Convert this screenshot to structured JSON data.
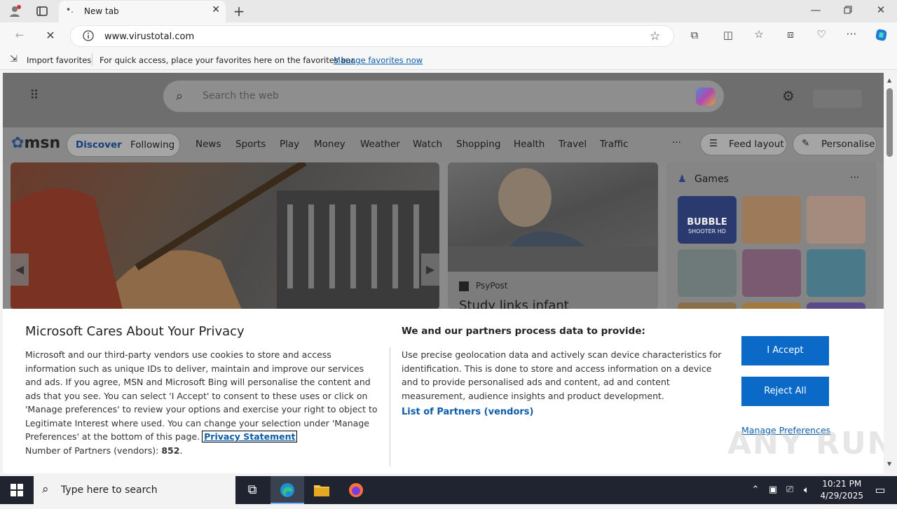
{
  "browser": {
    "tab_title": "New tab",
    "url": "www.virustotal.com",
    "favorites_bar": {
      "import_label": "Import favorites",
      "hint": "For quick access, place your favorites here on the favorites bar.",
      "manage_link": "Manage favorites now"
    }
  },
  "msn": {
    "search_placeholder": "Search the web",
    "logo": "msn",
    "tabs": [
      "Discover",
      "Following"
    ],
    "nav_items": [
      "News",
      "Sports",
      "Play",
      "Money",
      "Weather",
      "Watch",
      "Shopping",
      "Health",
      "Travel",
      "Traffic"
    ],
    "more": "···",
    "feed_layout": "Feed layout",
    "personalise": "Personalise",
    "article": {
      "source": "PsyPost",
      "headline": "Study links infant"
    },
    "games": {
      "title": "Games",
      "more": "···",
      "bubble_label_1": "BUBBLE",
      "bubble_label_2": "SHOOTER HD"
    }
  },
  "privacy": {
    "title": "Microsoft Cares About Your Privacy",
    "body": "Microsoft and our third-party vendors use cookies to store and access information such as unique IDs to deliver, maintain and improve our services and ads. If you agree, MSN and Microsoft Bing will personalise the content and ads that you see. You can select 'I Accept' to consent to these uses or click on 'Manage preferences' to review your options and exercise your right to object to Legitimate Interest where used.  You can change your selection under 'Manage Preferences' at the bottom of this page.",
    "privacy_link": "Privacy Statement",
    "partners_label": "Number of Partners (vendors):",
    "partners_count": "852",
    "right_heading": "We and our partners process data to provide:",
    "right_body": "Use precise geolocation data and actively scan device characteristics for identification. This is done to store and access information on a device and to provide personalised ads and content, ad and content measurement, audience insights and product development.",
    "list_partners": "List of Partners (vendors)",
    "accept": "I Accept",
    "reject": "Reject All",
    "manage": "Manage Preferences"
  },
  "taskbar": {
    "search_placeholder": "Type here to search",
    "time": "10:21 PM",
    "date": "4/29/2025"
  },
  "watermark": "ANY RUN"
}
